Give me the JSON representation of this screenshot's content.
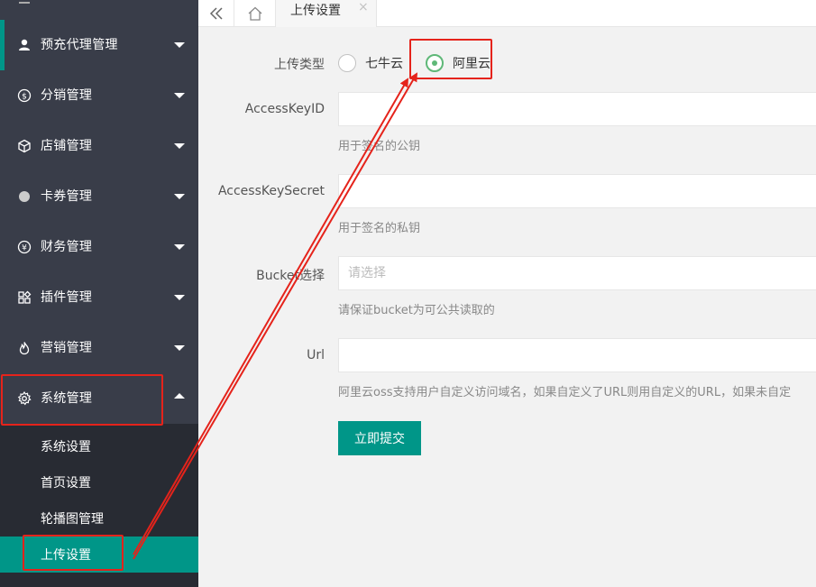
{
  "colors": {
    "sidebar_bg": "#393d49",
    "submenu_bg": "#282b33",
    "accent": "#009688",
    "radio_on": "#5fb878",
    "annotation": "#e5231b"
  },
  "sidebar": {
    "menu": [
      {
        "label": "预充代理管理",
        "icon": "user-icon"
      },
      {
        "label": "分销管理",
        "icon": "dollar-circle-icon"
      },
      {
        "label": "店铺管理",
        "icon": "cube-icon"
      },
      {
        "label": "卡券管理",
        "icon": "dot-circle-icon"
      },
      {
        "label": "财务管理",
        "icon": "yen-circle-icon"
      },
      {
        "label": "插件管理",
        "icon": "apps-icon"
      },
      {
        "label": "营销管理",
        "icon": "fire-icon"
      },
      {
        "label": "系统管理",
        "icon": "gear-icon"
      }
    ],
    "submenu": [
      {
        "label": "系统设置"
      },
      {
        "label": "首页设置"
      },
      {
        "label": "轮播图管理"
      },
      {
        "label": "上传设置"
      }
    ]
  },
  "tabs": {
    "current": "上传设置",
    "close": "×"
  },
  "form": {
    "upload_type": {
      "label": "上传类型",
      "options": [
        "七牛云",
        "阿里云"
      ],
      "selected": "阿里云"
    },
    "access_key_id": {
      "label": "AccessKeyID",
      "value": "",
      "help": "用于签名的公钥"
    },
    "access_key_secret": {
      "label": "AccessKeySecret",
      "value": "",
      "help": "用于签名的私钥"
    },
    "bucket": {
      "label": "Bucket选择",
      "placeholder": "请选择",
      "help": "请保证bucket为可公共读取的"
    },
    "url": {
      "label": "Url",
      "value": "",
      "help": "阿里云oss支持用户自定义访问域名，如果自定义了URL则用自定义的URL，如果未自定"
    },
    "submit": "立即提交"
  }
}
